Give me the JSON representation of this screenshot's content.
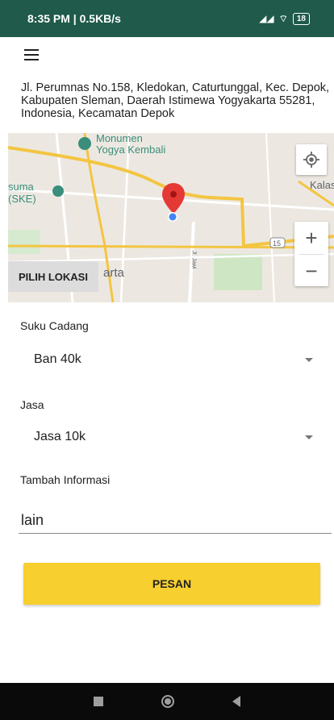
{
  "status_bar": {
    "time": "8:35 PM | 0.5KB/s",
    "battery": "18"
  },
  "header": {
    "menu_icon": "hamburger-menu-icon"
  },
  "address": "Jl. Perumnas No.158, Kledokan, Caturtunggal, Kec. Depok, Kabupaten Sleman, Daerah Istimewa Yogyakarta 55281, Indonesia, Kecamatan Depok",
  "map": {
    "labels": {
      "monumen": "Monumen",
      "monumen2": "Yogya Kembali",
      "suma": "suma",
      "ske": "(SKE)",
      "kalas": "Kalas",
      "arta": "arta",
      "road_15": "15",
      "jl_jawi": "Jl. Jawi"
    },
    "pick_location_label": "PILIH LOKASI",
    "zoom_in": "+",
    "zoom_out": "−",
    "pin_color": "#e53935",
    "marker_color": "#4285f4"
  },
  "form": {
    "spare_parts_label": "Suku Cadang",
    "spare_parts_value": "Ban 40k",
    "service_label": "Jasa",
    "service_value": "Jasa 10k",
    "extra_info_label": "Tambah Informasi",
    "extra_info_value": "lain",
    "submit_label": "PESAN",
    "submit_color": "#f7cf2e"
  }
}
